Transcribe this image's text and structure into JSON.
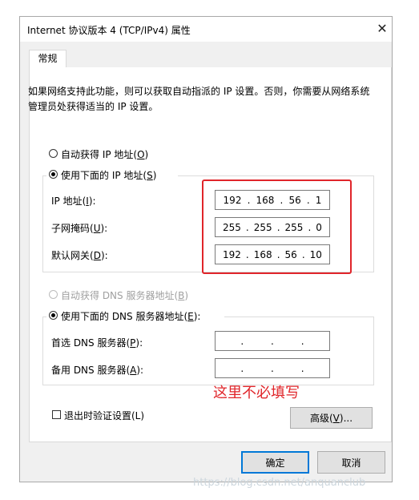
{
  "window": {
    "title": "Internet 协议版本 4 (TCP/IPv4) 属性"
  },
  "tabs": [
    {
      "label": "常规"
    }
  ],
  "description": "如果网络支持此功能，则可以获取自动指派的 IP 设置。否则，你需要从网络系统管理员处获得适当的 IP 设置。",
  "ip_section": {
    "auto_label": "自动获得 IP 地址(",
    "auto_key": "O",
    "manual_label": "使用下面的 IP 地址(",
    "manual_key": "S",
    "selected": "manual",
    "fields": [
      {
        "label": "IP 地址(",
        "key": "I",
        "octets": [
          "192",
          "168",
          "56",
          "1"
        ]
      },
      {
        "label": "子网掩码(",
        "key": "U",
        "octets": [
          "255",
          "255",
          "255",
          "0"
        ]
      },
      {
        "label": "默认网关(",
        "key": "D",
        "octets": [
          "192",
          "168",
          "56",
          "10"
        ]
      }
    ]
  },
  "dns_section": {
    "auto_label": "自动获得 DNS 服务器地址(",
    "auto_key": "B",
    "manual_label": "使用下面的 DNS 服务器地址(",
    "manual_key": "E",
    "selected": "manual",
    "fields": [
      {
        "label": "首选 DNS 服务器(",
        "key": "P",
        "octets": [
          "",
          "",
          "",
          ""
        ]
      },
      {
        "label": "备用 DNS 服务器(",
        "key": "A",
        "octets": [
          "",
          "",
          "",
          ""
        ]
      }
    ]
  },
  "annotation": {
    "text": "这里不必填写",
    "color": "#e0252a"
  },
  "validate_checkbox": {
    "label": "退出时验证设置(L)",
    "checked": false
  },
  "buttons": {
    "advanced": "高级(",
    "advanced_key": "V",
    "advanced_suffix": ")...",
    "ok": "确定",
    "cancel": "取消"
  },
  "watermark": "https://blog.csdn.net/anquanclub"
}
